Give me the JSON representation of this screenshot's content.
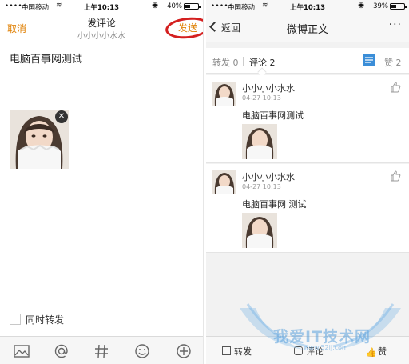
{
  "left": {
    "status": {
      "signal": "•••••",
      "carrier": "中国移动",
      "time": "上午10:13",
      "battery": "40%",
      "battery_level": 0.4
    },
    "header": {
      "cancel": "取消",
      "title": "发评论",
      "subtitle": "小小小小水水",
      "send": "发送"
    },
    "compose_text": "电脑百事网测试",
    "repost_label": "同时转发",
    "toolbar": [
      "image-icon",
      "mention-icon",
      "hashtag-icon",
      "emoji-icon",
      "add-icon"
    ]
  },
  "right": {
    "status": {
      "signal": "•••••",
      "carrier": "中国移动",
      "time": "上午10:13",
      "battery": "39%",
      "battery_level": 0.39
    },
    "header": {
      "back": "返回",
      "title": "微博正文",
      "more": "···"
    },
    "tabs": {
      "repost": "转发 0",
      "comment": "评论 2",
      "like": "赞 2"
    },
    "comments": [
      {
        "name": "小小小小水水",
        "time": "04-27 10:13",
        "text": "电脑百事网测试"
      },
      {
        "name": "小小小小水水",
        "time": "04-27 10:13",
        "text": "电脑百事网 测试"
      }
    ],
    "bottom": {
      "repost": "转发",
      "comment": "评论",
      "like": "赞"
    }
  },
  "watermark": {
    "text": "我爱IT技术网",
    "url": "www.52ij.com"
  },
  "colors": {
    "accent": "#e0830a",
    "annotation": "#d42020",
    "link_blue": "#3b8ed8"
  }
}
